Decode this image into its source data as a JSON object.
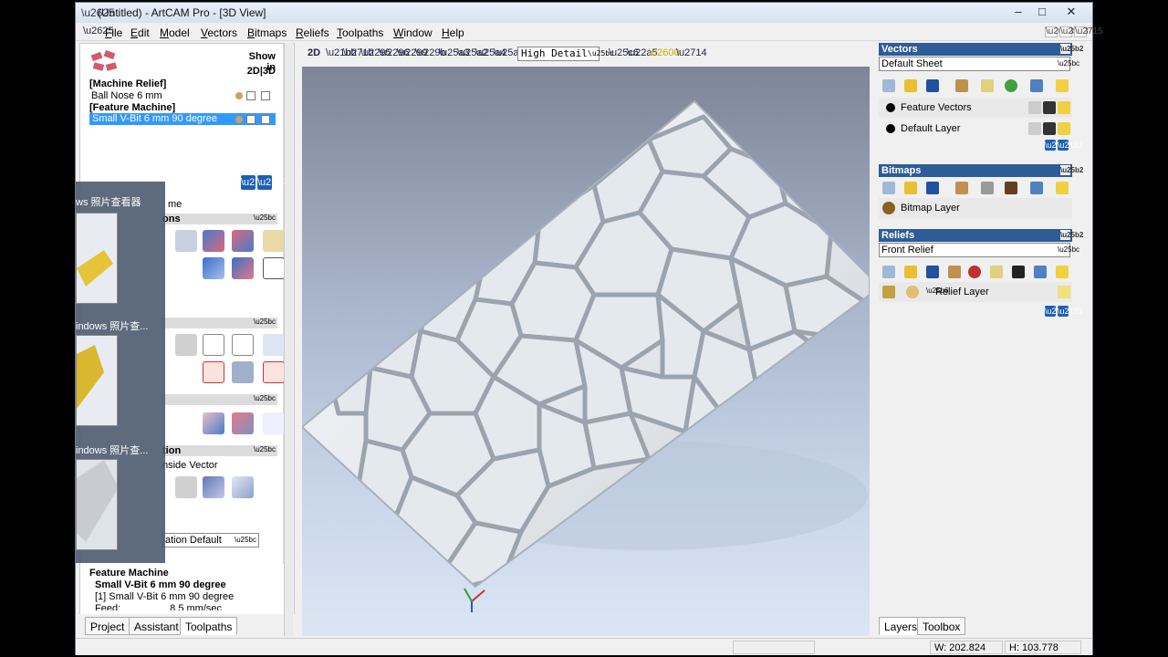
{
  "window": {
    "title": "(Untitled) - ArtCAM Pro - [3D View]",
    "minimize": "–",
    "maximize": "□",
    "close": "✕"
  },
  "menu": [
    "File",
    "Edit",
    "Model",
    "Vectors",
    "Bitmaps",
    "Reliefs",
    "Toolpaths",
    "Window",
    "Help"
  ],
  "left_panel": {
    "show_in": "Show in",
    "show_in_modes": "2D|3D",
    "groups": [
      {
        "name": "[Machine Relief]",
        "toolpath": "Ball Nose 6 mm"
      },
      {
        "name": "[Feature Machine]",
        "toolpath": "Small V-Bit 6 mm 90 degree"
      }
    ],
    "partial_texts": [
      "me",
      "ons",
      "nside Vector",
      "ation Default",
      "tion"
    ],
    "feature_box": {
      "title": "Feature Machine",
      "tool": "Small V-Bit 6 mm 90 degree",
      "line1": "[1] Small V-Bit 6 mm 90 degree",
      "feed_label": "Feed:",
      "feed_value": "8.5 mm/sec"
    },
    "tabs": [
      "Project",
      "Assistant",
      "Toolpaths"
    ]
  },
  "thumbnails": {
    "labels": [
      "ws 照片查看器",
      "indows 照片查...",
      "indows 照片查..."
    ]
  },
  "view": {
    "mode_2d": "2D",
    "detail": "High Detail"
  },
  "right_panel": {
    "vectors": {
      "header": "Vectors",
      "sheet": "Default Sheet",
      "layers": [
        "Feature Vectors",
        "Default Layer"
      ]
    },
    "bitmaps": {
      "header": "Bitmaps",
      "layers": [
        "Bitmap Layer"
      ]
    },
    "reliefs": {
      "header": "Reliefs",
      "relief": "Front Relief",
      "layers": [
        "Relief Layer"
      ]
    },
    "tabs": [
      "Layers",
      "Toolbox"
    ]
  },
  "status": {
    "width": "W: 202.824",
    "height": "H: 103.778"
  },
  "colors": {
    "panel_header": "#2e5c96",
    "selection": "#3399ff",
    "arrow_button": "#1e5fb4"
  }
}
